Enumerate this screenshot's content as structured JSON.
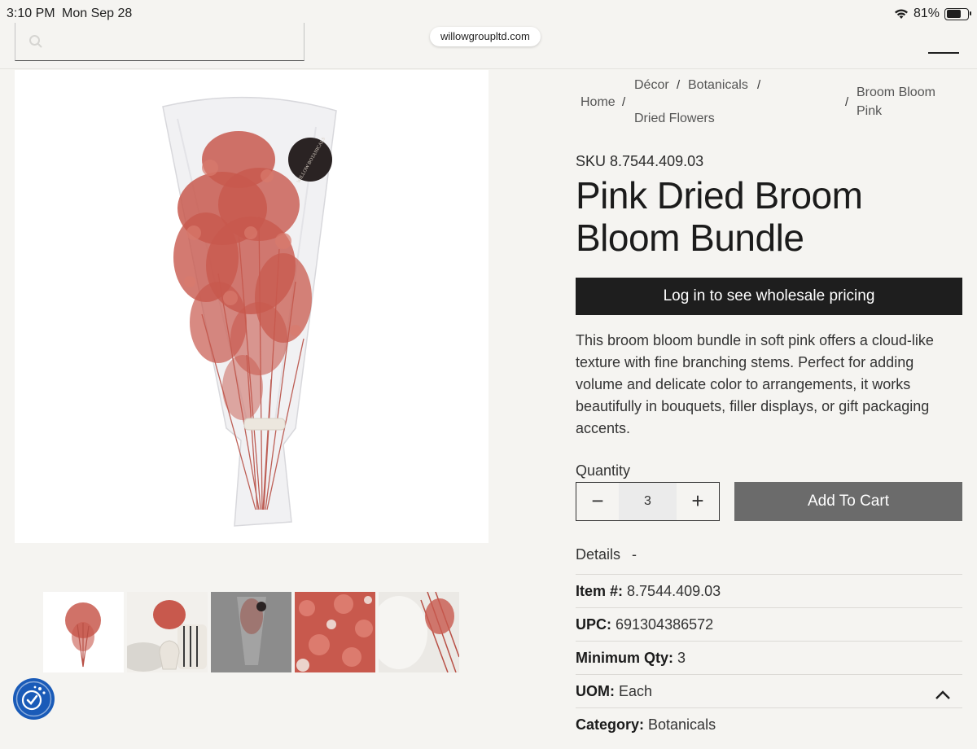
{
  "status_bar": {
    "time": "3:10 PM",
    "date": "Mon Sep 28",
    "battery": "81%",
    "battery_level": 0.81
  },
  "browser": {
    "url": "willowgroupltd.com"
  },
  "header": {
    "search_placeholder": ""
  },
  "breadcrumb": {
    "home": "Home",
    "decor": "Décor",
    "botanicals": "Botanicals",
    "dried_flowers": "Dried Flowers",
    "current_line1": "Broom Bloom",
    "current_line2": "Pink",
    "separator": "/"
  },
  "product": {
    "sku": "SKU 8.7544.409.03",
    "title": "Pink Dried Broom Bloom Bundle",
    "login_button": "Log in to see wholesale pricing",
    "description": "This broom bloom bundle in soft pink offers a cloud-like texture with fine branching stems. Perfect for adding volume and delicate color to arrangements, it works beautifully in bouquets, filler displays, or gift packaging accents.",
    "quantity_label": "Quantity",
    "quantity_value": "3",
    "minus": "−",
    "plus": "+",
    "add_to_cart": "Add To Cart",
    "brand_tag": "WILLOW BOTANICALS"
  },
  "details": {
    "heading": "Details",
    "toggle": "-",
    "rows": [
      {
        "label": "Item #:",
        "value": " 8.7544.409.03"
      },
      {
        "label": "UPC:",
        "value": " 691304386572"
      },
      {
        "label": "Minimum Qty:",
        "value": " 3"
      },
      {
        "label": "UOM:",
        "value": " Each"
      },
      {
        "label": "Category:",
        "value": " Botanicals"
      }
    ]
  },
  "colors": {
    "accent_dark": "#1e1e1e",
    "cart_button": "#6b6b6b",
    "flower": "#c8594d",
    "a11y_blue": "#1a5bb8"
  }
}
